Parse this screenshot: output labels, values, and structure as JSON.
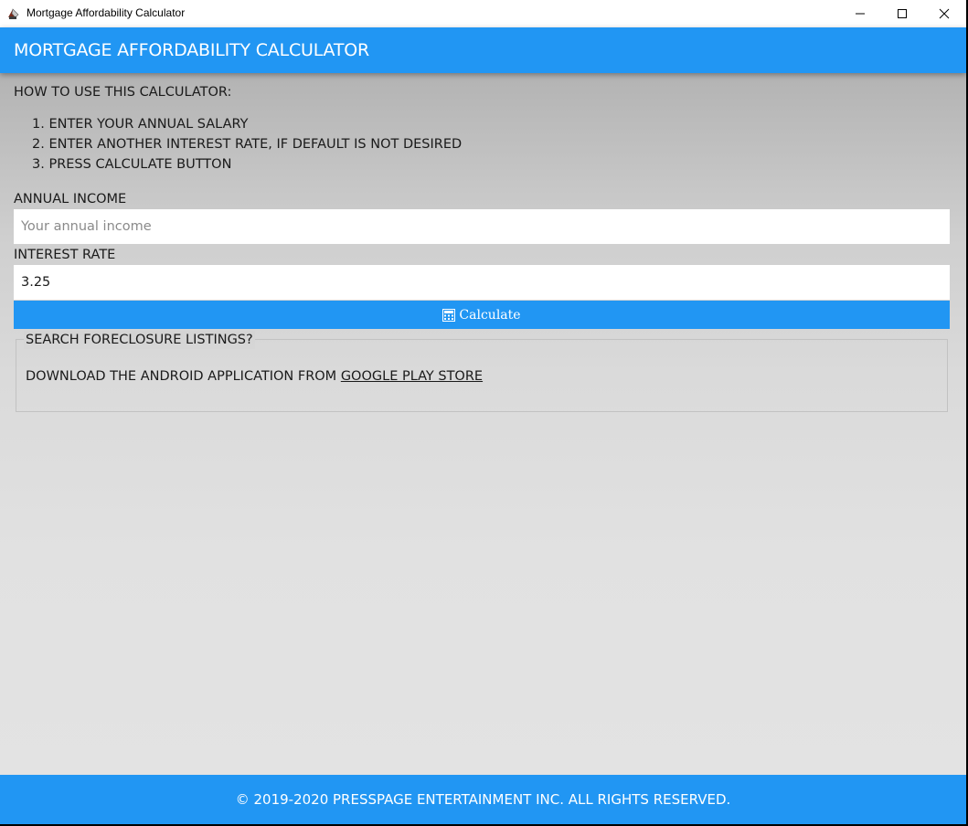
{
  "window": {
    "title": "Mortgage Affordability Calculator",
    "minimize": "─",
    "maximize": "☐",
    "close": "✕"
  },
  "header": {
    "title": "MORTGAGE AFFORDABILITY CALCULATOR"
  },
  "instructions": {
    "heading": "HOW TO USE THIS CALCULATOR:",
    "steps": [
      "1. ENTER YOUR ANNUAL SALARY",
      "2. ENTER ANOTHER INTEREST RATE, IF DEFAULT IS NOT DESIRED",
      "3. PRESS CALCULATE BUTTON"
    ]
  },
  "form": {
    "income_label": "ANNUAL INCOME",
    "income_value": "",
    "income_placeholder": "Your annual income",
    "rate_label": "INTEREST RATE",
    "rate_value": "3.25",
    "calculate_label": "Calculate"
  },
  "foreclosure": {
    "legend": "SEARCH FORECLOSURE LISTINGS?",
    "text": "DOWNLOAD THE ANDROID APPLICATION FROM ",
    "link_label": "GOOGLE PLAY STORE"
  },
  "footer": {
    "text": "© 2019-2020 PRESSPAGE ENTERTAINMENT INC. ALL RIGHTS RESERVED."
  },
  "colors": {
    "accent": "#2196f3",
    "background": "#e3e3e3"
  }
}
